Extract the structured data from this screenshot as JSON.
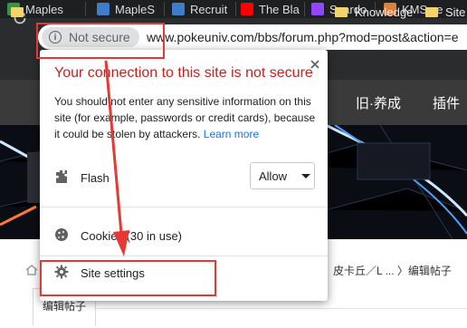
{
  "tabs": [
    {
      "label": "Maples",
      "favicon_color": "#2e9a47"
    },
    {
      "label": "MapleS",
      "favicon_color": "#3f7cc9"
    },
    {
      "label": "Recruit",
      "favicon_color": "#3f7cc9"
    },
    {
      "label": "The Bla",
      "favicon_color": "#ff0000"
    },
    {
      "label": "Scardo",
      "favicon_color": "#9146ff"
    },
    {
      "label": "KMS ve",
      "favicon_color": "#d9823b"
    }
  ],
  "toolbar": {
    "security_label": "Not secure",
    "security_icon": "info-icon",
    "url": "www.pokeuniv.com/bbs/forum.php?mod=post&action=e"
  },
  "bookmarks": [
    {
      "label": "Knowledge"
    },
    {
      "label": "Site"
    }
  ],
  "page": {
    "nav_items": [
      "旧·养成",
      "插件"
    ],
    "breadcrumb_tail": "皮卡丘／L ... 〉编辑帖子",
    "active_tab": "编辑帖子"
  },
  "popup": {
    "title": "Your connection to this site is not secure",
    "description": "You should not enter any sensitive information on this site (for example, passwords or credit cards), because it could be stolen by attackers.",
    "learn_more": "Learn more",
    "flash_label": "Flash",
    "flash_value": "Allow",
    "cookies_label": "Cookies (30 in use)",
    "site_settings_label": "Site settings"
  },
  "colors": {
    "warning_red": "#c5221f",
    "link_blue": "#1a73e8",
    "annotation_red": "#e53935"
  }
}
